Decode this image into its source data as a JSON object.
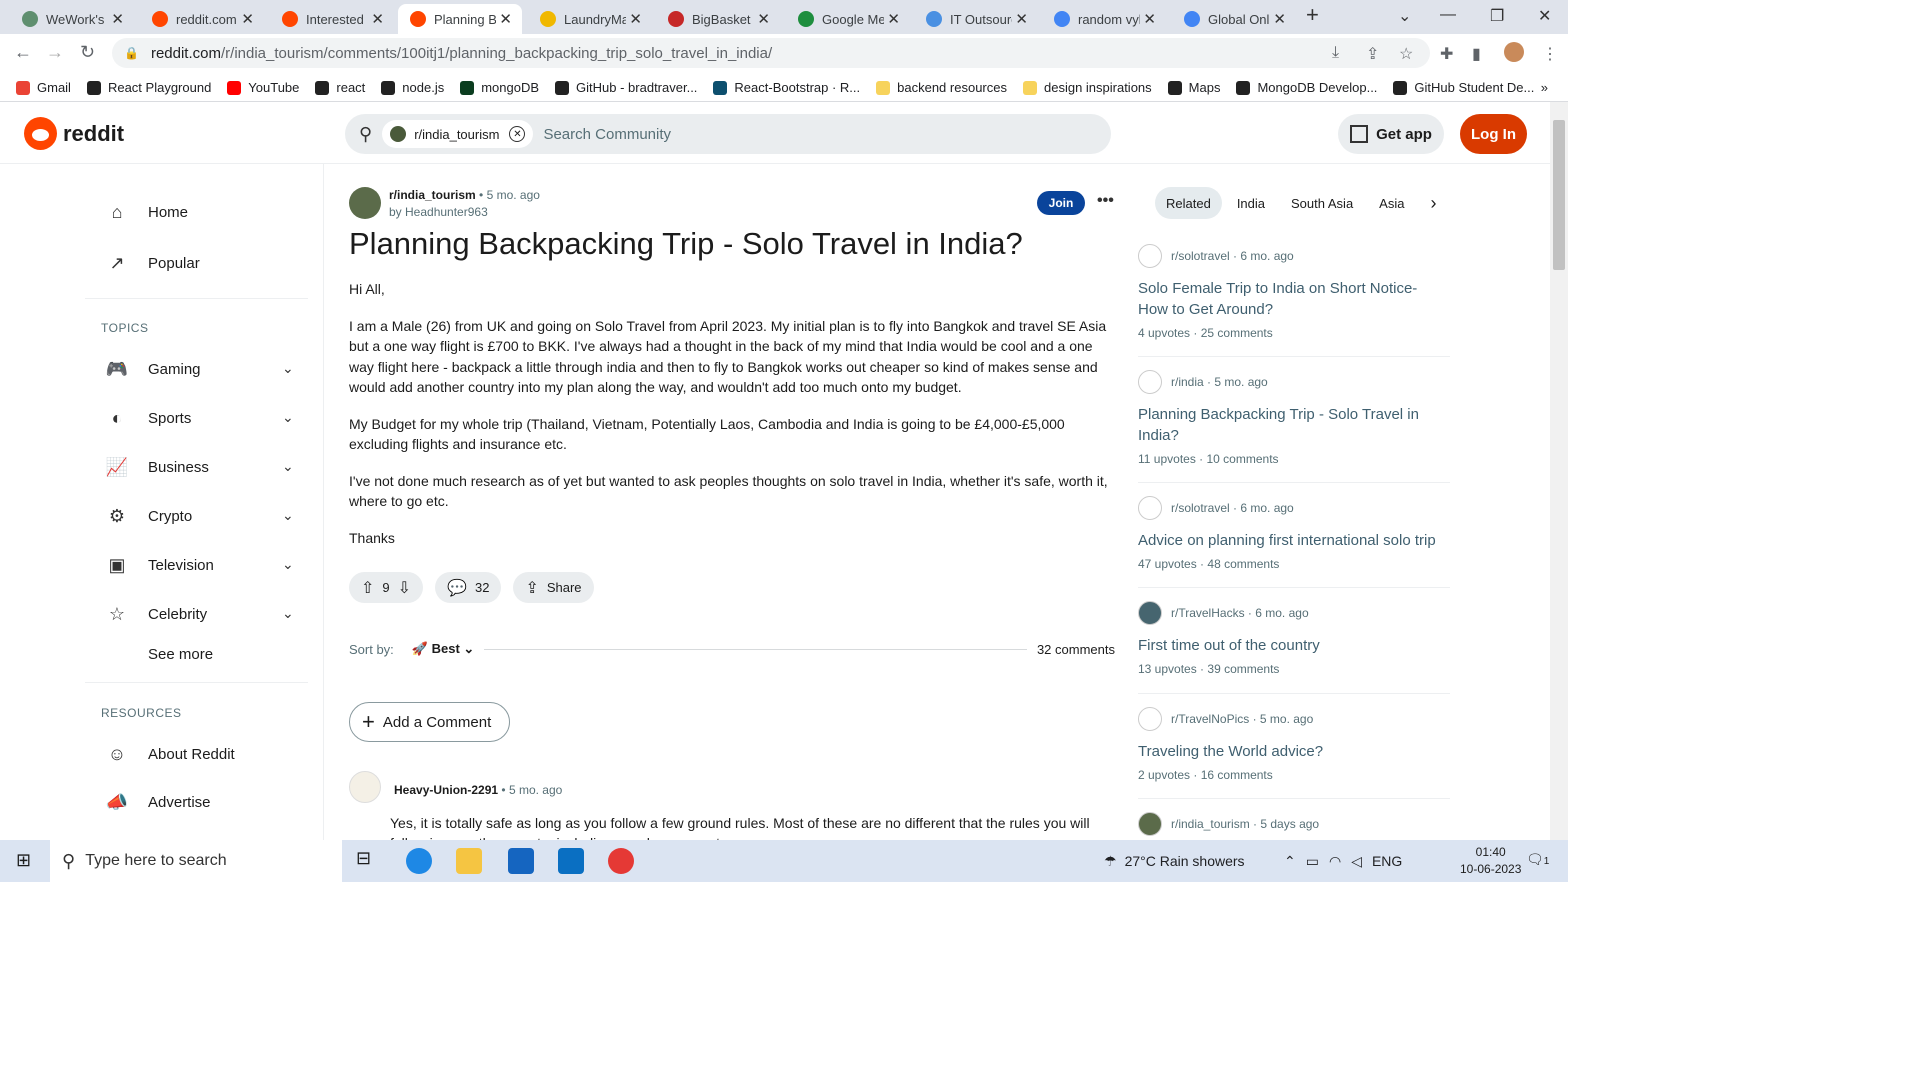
{
  "browser": {
    "tabs": [
      {
        "title": "WeWork's U",
        "color": "#5f8f6f"
      },
      {
        "title": "reddit.com",
        "color": "#ff4500"
      },
      {
        "title": "Interested i",
        "color": "#ff4500"
      },
      {
        "title": "Planning Ba",
        "color": "#ff4500"
      },
      {
        "title": "LaundryMa",
        "color": "#f0b800"
      },
      {
        "title": "BigBasket c",
        "color": "#c62828"
      },
      {
        "title": "Google Me",
        "color": "#1e8e3e"
      },
      {
        "title": "IT Outsourc",
        "color": "#4a90e2"
      },
      {
        "title": "random vyl",
        "color": "#4285f4"
      },
      {
        "title": "Global Onli",
        "color": "#4285f4"
      }
    ],
    "active_tab": 3,
    "url_host": "reddit.com",
    "url_path": "/r/india_tourism/comments/100itj1/planning_backpacking_trip_solo_travel_in_india/",
    "bookmarks": [
      {
        "label": "Gmail",
        "color": "#ea4335"
      },
      {
        "label": "React Playground",
        "color": "#222"
      },
      {
        "label": "YouTube",
        "color": "#ff0000"
      },
      {
        "label": "react",
        "color": "#222"
      },
      {
        "label": "node.js",
        "color": "#222"
      },
      {
        "label": "mongoDB",
        "color": "#0b3d1f"
      },
      {
        "label": "GitHub - bradtraver...",
        "color": "#222"
      },
      {
        "label": "React-Bootstrap · R...",
        "color": "#0d4f6e"
      },
      {
        "label": "backend resources",
        "color": "#f7d35c"
      },
      {
        "label": "design inspirations",
        "color": "#f7d35c"
      },
      {
        "label": "Maps",
        "color": "#222"
      },
      {
        "label": "MongoDB Develop...",
        "color": "#222"
      },
      {
        "label": "GitHub Student De...",
        "color": "#222"
      }
    ],
    "bookmarks_more": "»"
  },
  "header": {
    "logo_text": "reddit",
    "community_chip": "r/india_tourism",
    "search_placeholder": "Search Community",
    "get_app": "Get app",
    "login": "Log In"
  },
  "sidebar": {
    "top": [
      {
        "label": "Home",
        "icon": "⌂"
      },
      {
        "label": "Popular",
        "icon": "↗"
      }
    ],
    "topics_heading": "TOPICS",
    "topics": [
      {
        "label": "Gaming",
        "icon": "🎮"
      },
      {
        "label": "Sports",
        "icon": "◐"
      },
      {
        "label": "Business",
        "icon": "📈"
      },
      {
        "label": "Crypto",
        "icon": "⚙"
      },
      {
        "label": "Television",
        "icon": "▣"
      },
      {
        "label": "Celebrity",
        "icon": "☆"
      }
    ],
    "see_more": "See more",
    "resources_heading": "RESOURCES",
    "resources": [
      {
        "label": "About Reddit",
        "icon": "☺"
      },
      {
        "label": "Advertise",
        "icon": "📣"
      }
    ]
  },
  "post": {
    "subreddit": "r/india_tourism",
    "age": "• 5 mo. ago",
    "author": "by Headhunter963",
    "join": "Join",
    "more": "•••",
    "title": "Planning Backpacking Trip - Solo Travel in India?",
    "paragraphs": [
      "Hi All,",
      "I am a Male (26) from UK and going on Solo Travel from April 2023. My initial plan is to fly into Bangkok and travel SE Asia but a one way flight is £700 to BKK. I've always had a thought in the back of my mind that India would be cool and a one way flight here - backpack a little through india and then to fly to Bangkok works out cheaper so kind of makes sense and would add another country into my plan along the way, and wouldn't add too much onto my budget.",
      "My Budget for my whole trip (Thailand, Vietnam, Potentially Laos, Cambodia and India is going to be £4,000-£5,000 excluding flights and insurance etc.",
      "I've not done much research as of yet but wanted to ask peoples thoughts on solo travel in India, whether it's safe, worth it, where to go etc.",
      "Thanks"
    ],
    "votes": "9",
    "comments": "32",
    "share": "Share"
  },
  "comments_section": {
    "sort_label": "Sort by:",
    "sort_value": "Best",
    "count": "32 comments",
    "add_comment": "Add a Comment",
    "first": {
      "user": "Heavy-Union-2291",
      "age": "5 mo. ago",
      "text": "Yes, it is totally safe as long as you follow a few ground rules. Most of these are no different that the rules you will follow in any other country including your home country."
    }
  },
  "related": {
    "tabs": [
      "Related",
      "India",
      "South Asia",
      "Asia"
    ],
    "items": [
      {
        "sub": "r/solotravel",
        "age": "6 mo. ago",
        "title": "Solo Female Trip to India on Short Notice- How to Get Around?",
        "upvotes": "4 upvotes",
        "comments": "25 comments",
        "icon_color": "#ffffff"
      },
      {
        "sub": "r/india",
        "age": "5 mo. ago",
        "title": "Planning Backpacking Trip - Solo Travel in India?",
        "upvotes": "11 upvotes",
        "comments": "10 comments",
        "icon_color": "#ffffff"
      },
      {
        "sub": "r/solotravel",
        "age": "6 mo. ago",
        "title": "Advice on planning first international solo trip",
        "upvotes": "47 upvotes",
        "comments": "48 comments",
        "icon_color": "#ffffff"
      },
      {
        "sub": "r/TravelHacks",
        "age": "6 mo. ago",
        "title": "First time out of the country",
        "upvotes": "13 upvotes",
        "comments": "39 comments",
        "icon_color": "#46656f"
      },
      {
        "sub": "r/TravelNoPics",
        "age": "5 mo. ago",
        "title": "Traveling the World advice?",
        "upvotes": "2 upvotes",
        "comments": "16 comments",
        "icon_color": "#ffffff"
      },
      {
        "sub": "r/india_tourism",
        "age": "5 days ago",
        "title": "",
        "upvotes": "",
        "comments": "",
        "icon_color": "#5b6b4a"
      }
    ]
  },
  "taskbar": {
    "search_placeholder": "Type here to search",
    "weather": "27°C  Rain showers",
    "lang": "ENG",
    "time": "01:40",
    "date": "10-06-2023",
    "notifications": "1"
  }
}
